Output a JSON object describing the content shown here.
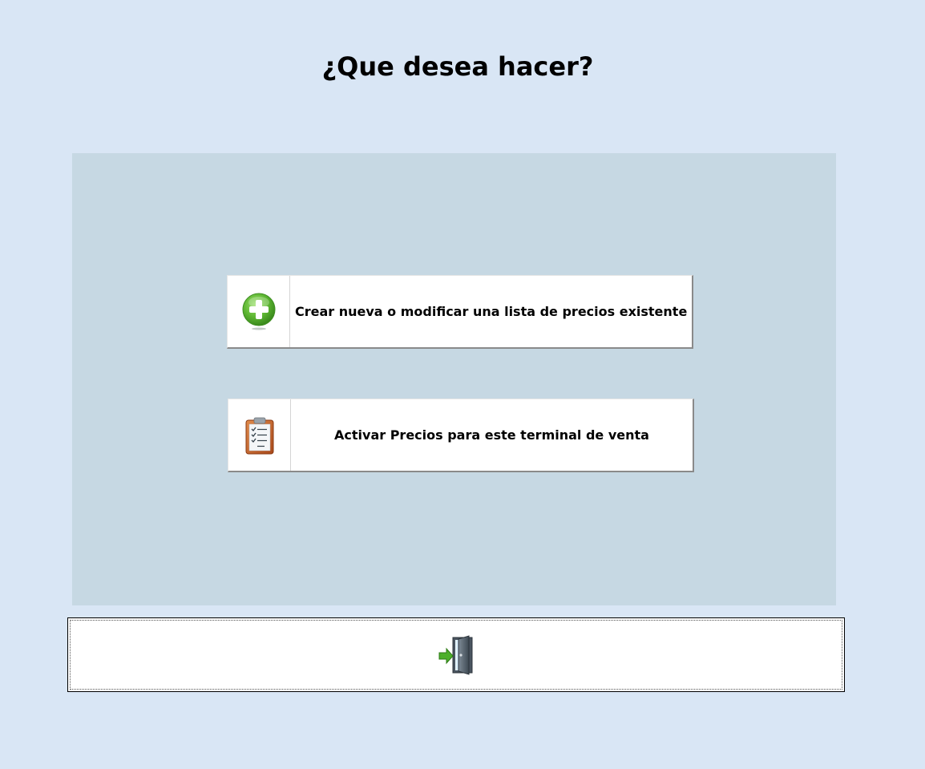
{
  "header": {
    "title": "¿Que desea hacer?"
  },
  "options": [
    {
      "label": "Crear nueva o modificar una lista de precios existente",
      "icon": "plus-circle-icon",
      "icon_color": "#5cb531"
    },
    {
      "label": "Activar Precios para este terminal de venta",
      "icon": "clipboard-checklist-icon",
      "icon_color": "#c8642a"
    }
  ],
  "exit": {
    "icon": "exit-door-icon"
  },
  "colors": {
    "background": "#d9e6f5",
    "panel": "#c6d8e3",
    "button": "#ffffff"
  }
}
